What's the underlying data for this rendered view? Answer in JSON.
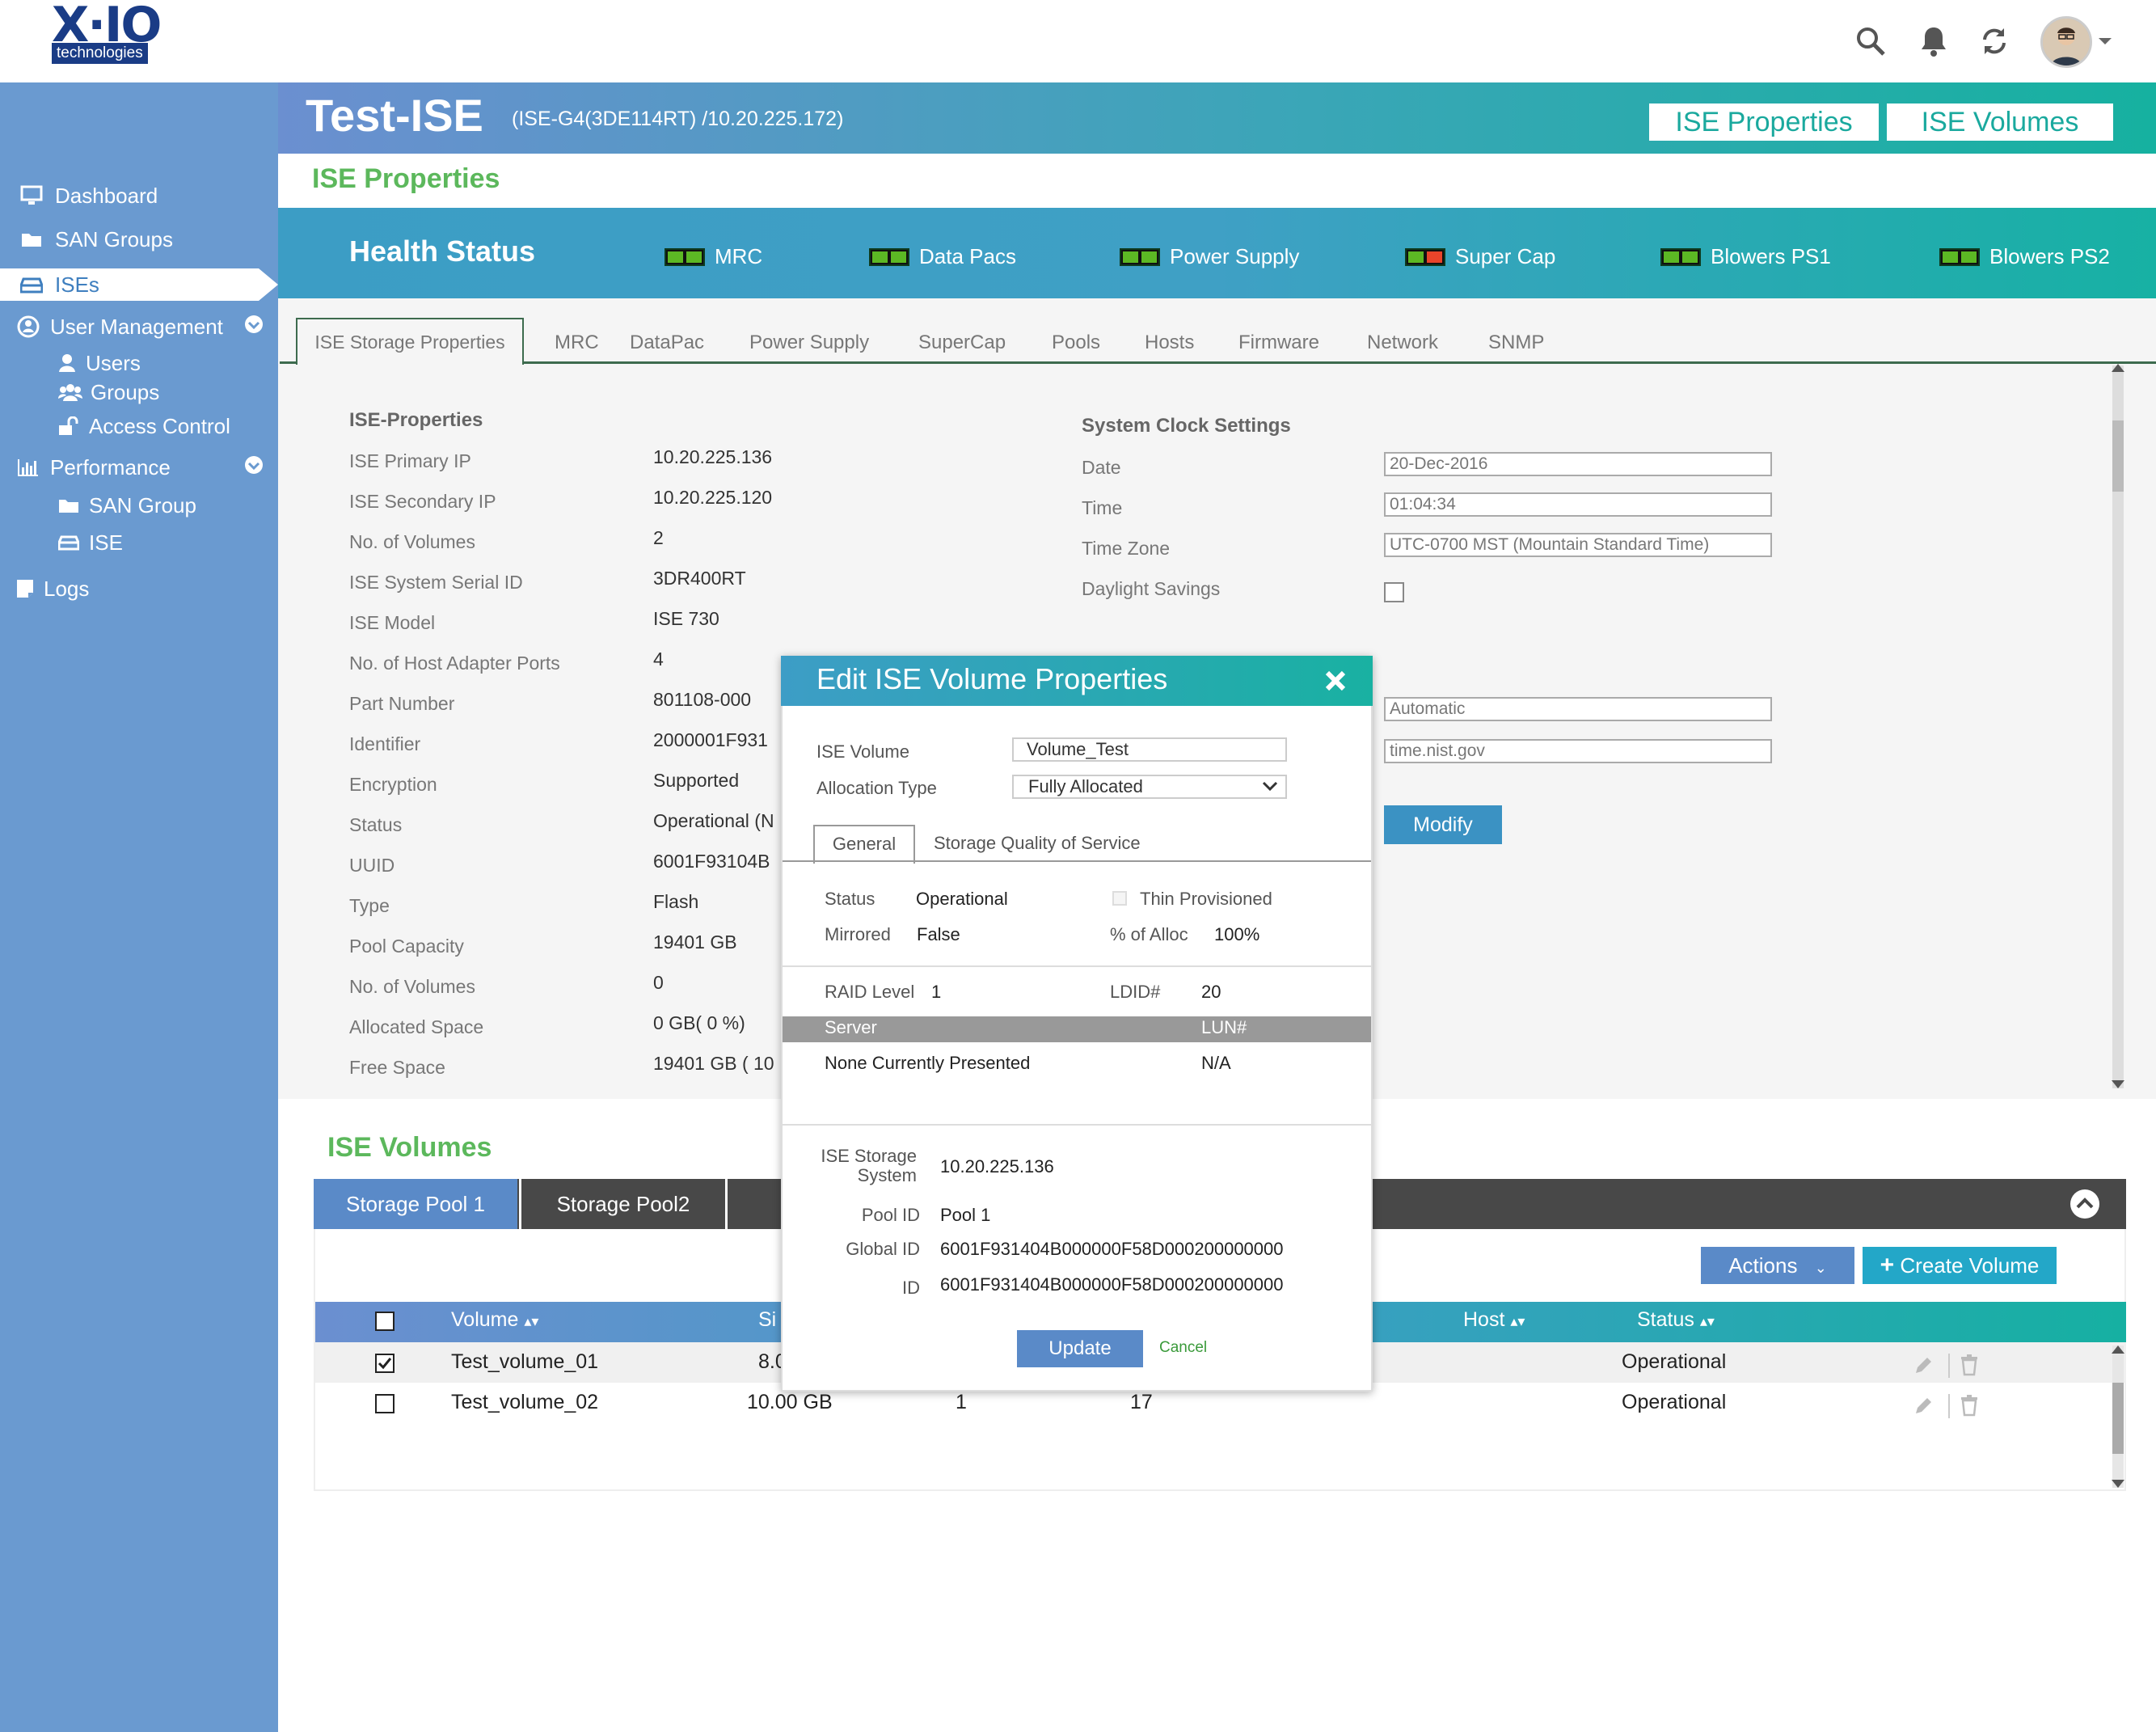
{
  "brand": {
    "logo_main": "X·IO",
    "logo_sub": "technologies"
  },
  "header": {
    "title": "Test-ISE",
    "subtitle": "(ISE-G4(3DE114RT) /10.20.225.172)",
    "btn_properties": "ISE Properties",
    "btn_volumes": "ISE Volumes"
  },
  "sidebar": {
    "items": [
      "Dashboard",
      "SAN Groups",
      "ISEs",
      "User Management",
      "Users",
      "Groups",
      "Access Control",
      "Performance",
      "SAN Group",
      "ISE",
      "Logs"
    ]
  },
  "page_title": "ISE Properties",
  "health": {
    "title": "Health Status",
    "items": [
      "MRC",
      "Data Pacs",
      "Power Supply",
      "Super Cap",
      "Blowers PS1",
      "Blowers PS2"
    ]
  },
  "tabs": [
    "ISE Storage Properties",
    "MRC",
    "DataPac",
    "Power Supply",
    "SuperCap",
    "Pools",
    "Hosts",
    "Firmware",
    "Network",
    "SNMP"
  ],
  "props": {
    "heading": "ISE-Properties",
    "labels": [
      "ISE Primary IP",
      "ISE Secondary IP",
      "No. of Volumes",
      "ISE System Serial ID",
      "ISE Model",
      "No. of Host Adapter Ports",
      "Part Number",
      "Identifier",
      "Encryption",
      "Status",
      "UUID",
      "Type",
      "Pool Capacity",
      "No. of Volumes",
      "Allocated Space",
      "Free Space"
    ],
    "values": [
      "10.20.225.136",
      "10.20.225.120",
      "2",
      "3DR400RT",
      "ISE 730",
      "4",
      "801108-000",
      "2000001F931",
      "Supported",
      "Operational (N",
      "6001F93104B",
      "Flash",
      "19401 GB",
      "0",
      "0 GB( 0 %)",
      "19401 GB ( 10"
    ]
  },
  "clock": {
    "heading": "System Clock Settings",
    "date_label": "Date",
    "date_value": "20-Dec-2016",
    "time_label": "Time",
    "time_value": "01:04:34",
    "tz_label": "Time Zone",
    "tz_value": "UTC-0700 MST (Mountain Standard Time)",
    "dst_label": "Daylight Savings",
    "ntp_mode": "Automatic",
    "ntp_server": "time.nist.gov",
    "modify": "Modify"
  },
  "volumes": {
    "title": "ISE Volumes",
    "pool_tabs": [
      "Storage Pool 1",
      "Storage Pool2"
    ],
    "actions": "Actions",
    "create": "Create Volume",
    "columns": {
      "volume": "Volume",
      "size": "Si",
      "host": "Host",
      "status": "Status"
    },
    "rows": [
      {
        "name": "Test_volume_01",
        "size": "8.0",
        "c3": "",
        "c4": "",
        "status": "Operational",
        "checked": true
      },
      {
        "name": "Test_volume_02",
        "size": "10.00 GB",
        "c3": "1",
        "c4": "17",
        "status": "Operational",
        "checked": false
      }
    ]
  },
  "modal": {
    "title": "Edit ISE Volume Properties",
    "volume_label": "ISE  Volume",
    "volume_value": "Volume_Test",
    "alloc_label": "Allocation Type",
    "alloc_value": "Fully Allocated",
    "tab_general": "General",
    "tab_qos": "Storage Quality of Service",
    "status_label": "Status",
    "status_value": "Operational",
    "thin_label": "Thin Provisioned",
    "mirrored_label": "Mirrored",
    "mirrored_value": "False",
    "alloc_pct_label": "% of Alloc",
    "alloc_pct_value": "100%",
    "raid_label": "RAID Level",
    "raid_value": "1",
    "ldid_label": "LDID#",
    "ldid_value": "20",
    "server_col": "Server",
    "lun_col": "LUN#",
    "server_value": "None Currently Presented",
    "lun_value": "N/A",
    "storage_label_1": "ISE Storage",
    "storage_label_2": "System",
    "storage_value": "10.20.225.136",
    "pool_label": "Pool ID",
    "pool_value": "Pool 1",
    "global_label": "Global ID",
    "global_value": "6001F931404B000000F58D000200000000",
    "id_label": "ID",
    "id_value": "6001F931404B000000F58D000200000000",
    "update": "Update",
    "cancel": "Cancel"
  },
  "colors": {
    "accent_green": "#5cb85c",
    "sidebar": "#6a9ad0",
    "teal": "#17b1a4",
    "led_green": "#5cb824",
    "led_red": "#e9442a"
  }
}
